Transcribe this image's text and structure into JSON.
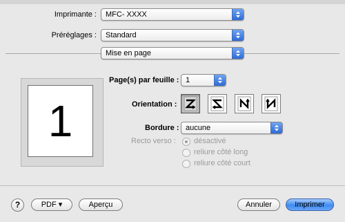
{
  "printer": {
    "label": "Imprimante :",
    "value": "MFC- XXXX"
  },
  "presets": {
    "label": "Préréglages :",
    "value": "Standard"
  },
  "pane": {
    "value": "Mise en page"
  },
  "preview": {
    "number": "1"
  },
  "pages_per_sheet": {
    "label": "Page(s) par feuille :",
    "value": "1"
  },
  "orientation": {
    "label": "Orientation :",
    "options": [
      "Z",
      "Z-reversed",
      "N",
      "N-reversed"
    ],
    "selected_index": 0
  },
  "border": {
    "label": "Bordure :",
    "value": "aucune"
  },
  "duplex": {
    "label": "Recto verso :",
    "options": [
      "désactivé",
      "reliure côté long",
      "reliure côté court"
    ],
    "selected_index": 0,
    "enabled": false
  },
  "buttons": {
    "help": "?",
    "pdf": "PDF ▾",
    "preview": "Aperçu",
    "cancel": "Annuler",
    "print": "Imprimer"
  },
  "colors": {
    "accent": "#3f8bf0",
    "disabled_text": "#9a9a9a"
  }
}
